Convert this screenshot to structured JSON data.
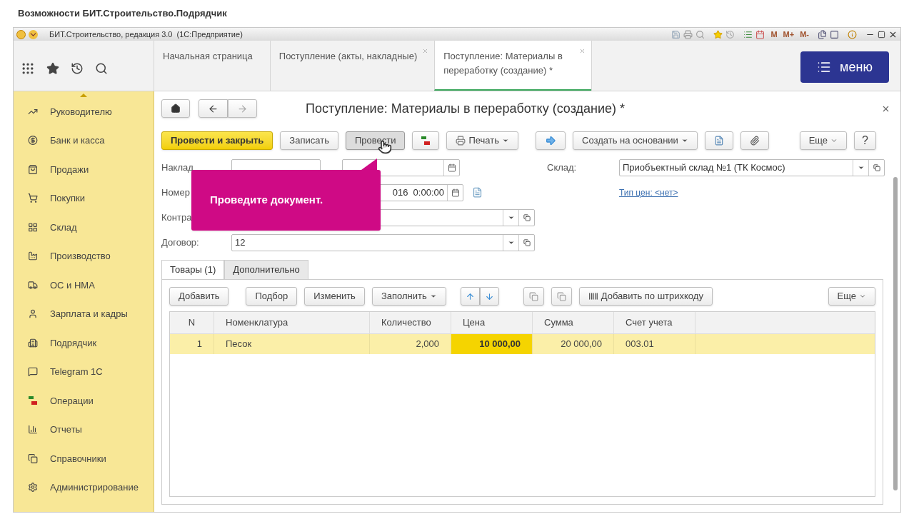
{
  "page_title": "Возможности БИТ.Строительство.Подрядчик",
  "window": {
    "title": "БИТ.Строительство, редакция 3.0  (1С:Предприятие)",
    "memory_keys": [
      "M",
      "M+",
      "M-"
    ]
  },
  "app_tabs": [
    {
      "label": "Начальная страница",
      "selected": false,
      "closable": false
    },
    {
      "label": "Поступление (акты, накладные)",
      "selected": false,
      "closable": true
    },
    {
      "label": "Поступление: Материалы в переработку (создание) *",
      "selected": true,
      "closable": true
    }
  ],
  "menu_button": {
    "label": "меню"
  },
  "sidebar": {
    "items": [
      {
        "label": "Руководителю"
      },
      {
        "label": "Банк и касса"
      },
      {
        "label": "Продажи"
      },
      {
        "label": "Покупки"
      },
      {
        "label": "Склад"
      },
      {
        "label": "Производство"
      },
      {
        "label": "ОС и НМА"
      },
      {
        "label": "Зарплата и кадры"
      },
      {
        "label": "Подрядчик"
      },
      {
        "label": "Telegram 1С"
      },
      {
        "label": "Операции"
      },
      {
        "label": "Отчеты"
      },
      {
        "label": "Справочники"
      },
      {
        "label": "Администрирование"
      }
    ]
  },
  "document": {
    "title": "Поступление: Материалы в переработку (создание) *",
    "commands": [
      {
        "kind": "primary",
        "label": "Провести и закрыть",
        "pressed": false,
        "dropdown": false
      },
      {
        "kind": "text",
        "label": "Записать",
        "pressed": false,
        "dropdown": false
      },
      {
        "kind": "text",
        "label": "Провести",
        "pressed": true,
        "dropdown": false
      },
      {
        "kind": "icon",
        "pressed": false,
        "dropdown": false
      },
      {
        "kind": "icon-text",
        "label": "Печать",
        "pressed": false,
        "dropdown": true
      },
      {
        "kind": "icon",
        "pressed": false,
        "dropdown": false
      },
      {
        "kind": "text",
        "label": "Создать на основании",
        "pressed": false,
        "dropdown": true
      },
      {
        "kind": "icon",
        "pressed": false,
        "dropdown": false
      },
      {
        "kind": "icon",
        "pressed": false,
        "dropdown": false
      }
    ],
    "more_button": {
      "label": "Еще"
    },
    "help_button": {
      "label": "?"
    },
    "fields": [
      {
        "label": "Наклад",
        "kind": "number-date"
      },
      {
        "label": "Номер",
        "kind": "date",
        "value": "016  0:00:00"
      },
      {
        "label": "Контра",
        "kind": "select"
      },
      {
        "label": "Договор:",
        "kind": "select",
        "value": "12"
      }
    ],
    "warehouse": {
      "label": "Склад:",
      "value": "Приобъектный склад №1 (ТК Космос)"
    },
    "price_type_link": "Тип цен: <нет>",
    "callout": {
      "text": "Проведите документ."
    },
    "tabs": [
      {
        "label": "Товары (1)",
        "selected": true
      },
      {
        "label": "Дополнительно",
        "selected": false
      }
    ],
    "table_toolbar": [
      {
        "kind": "text",
        "label": "Добавить"
      },
      {
        "kind": "text",
        "label": "Подбор"
      },
      {
        "kind": "text",
        "label": "Изменить"
      },
      {
        "kind": "menu",
        "label": "Заполнить"
      },
      {
        "kind": "updown"
      },
      {
        "kind": "icon"
      },
      {
        "kind": "icon"
      },
      {
        "kind": "icon-text",
        "label": "Добавить по штрихкоду"
      }
    ],
    "table_more": {
      "label": "Еще"
    },
    "table": {
      "columns": [
        "N",
        "Номенклатура",
        "Количество",
        "Цена",
        "Сумма",
        "Счет учета"
      ],
      "rows": [
        {
          "selected": true,
          "cells": [
            {
              "text": "1",
              "selected": false
            },
            {
              "text": "Песок",
              "selected": false
            },
            {
              "text": "2,000",
              "selected": false
            },
            {
              "text": "10 000,00",
              "selected": true
            },
            {
              "text": "20 000,00",
              "selected": false
            },
            {
              "text": "003.01",
              "selected": false
            }
          ]
        }
      ]
    }
  }
}
